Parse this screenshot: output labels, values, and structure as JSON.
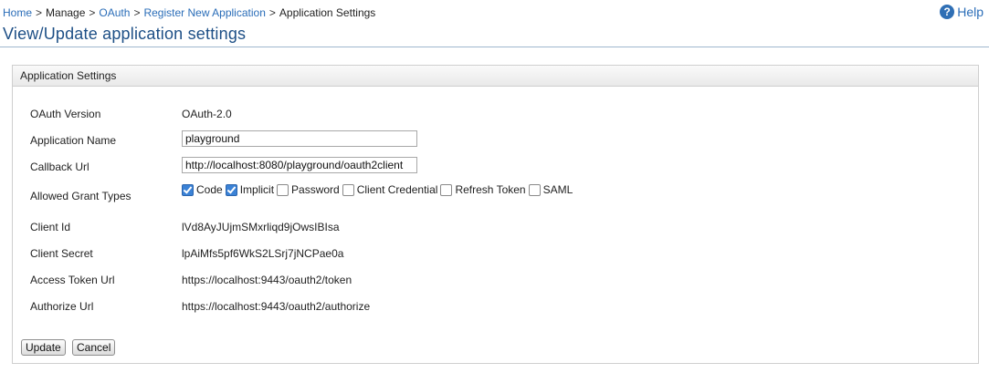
{
  "breadcrumb": {
    "home": "Home",
    "manage": "Manage",
    "oauth": "OAuth",
    "register": "Register New Application",
    "current": "Application Settings",
    "separator": ">"
  },
  "help": {
    "label": "Help",
    "icon": "question-circle-icon",
    "icon_glyph": "?"
  },
  "page_title": "View/Update application settings",
  "panel": {
    "header": "Application Settings",
    "fields": {
      "oauth_version": {
        "label": "OAuth Version",
        "value": "OAuth-2.0"
      },
      "app_name": {
        "label": "Application Name",
        "value": "playground"
      },
      "callback_url": {
        "label": "Callback Url",
        "value": "http://localhost:8080/playground/oauth2client"
      },
      "grant_types": {
        "label": "Allowed Grant Types",
        "options": [
          {
            "label": "Code",
            "checked": true
          },
          {
            "label": "Implicit",
            "checked": true
          },
          {
            "label": "Password",
            "checked": false
          },
          {
            "label": "Client Credential",
            "checked": false
          },
          {
            "label": "Refresh Token",
            "checked": false
          },
          {
            "label": "SAML",
            "checked": false
          }
        ]
      },
      "client_id": {
        "label": "Client Id",
        "value": "lVd8AyJUjmSMxrliqd9jOwsIBIsa"
      },
      "client_secret": {
        "label": "Client Secret",
        "value": "lpAiMfs5pf6WkS2LSrj7jNCPae0a"
      },
      "access_token_url": {
        "label": "Access Token Url",
        "value": "https://localhost:9443/oauth2/token"
      },
      "authorize_url": {
        "label": "Authorize Url",
        "value": "https://localhost:9443/oauth2/authorize"
      }
    }
  },
  "buttons": {
    "update": "Update",
    "cancel": "Cancel"
  },
  "colors": {
    "link": "#2a6db8",
    "title": "#1d4f86",
    "checkbox_checked": "#3b82d6"
  }
}
